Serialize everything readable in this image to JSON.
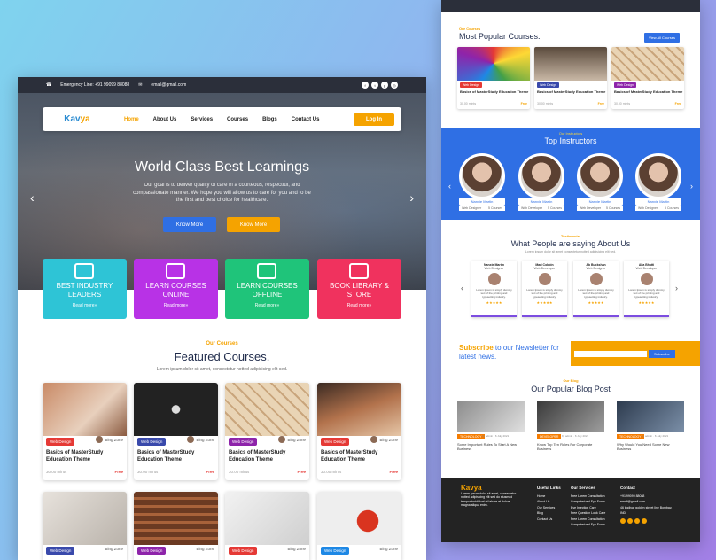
{
  "left": {
    "topbar": {
      "emergency": "Emergency Line: +91 99099 88088",
      "email": "email@gmail.com"
    },
    "nav": {
      "logo_a": "Kav",
      "logo_b": "ya",
      "items": [
        "Home",
        "About Us",
        "Services",
        "Courses",
        "Blogs",
        "Contact Us"
      ],
      "login": "Log In"
    },
    "hero": {
      "title": "World Class Best Learnings",
      "text": "Our goal is to deliver quality of care in a courteous, respectful, and compassionate manner. We hope you will allow us to care for you and to be the first and best choice for healthcare.",
      "btn1": "Know More",
      "btn2": "Know More"
    },
    "features": [
      {
        "title": "BEST INDUSTRY LEADERS",
        "link": "Read more»",
        "color": "#2ec4d6"
      },
      {
        "title": "LEARN COURSES ONLINE",
        "link": "Read more»",
        "color": "#b832e6"
      },
      {
        "title": "LEARN COURSES OFFLINE",
        "link": "Read more»",
        "color": "#1fc47a"
      },
      {
        "title": "BOOK LIBRARY & STORE",
        "link": "Read more»",
        "color": "#f0325e"
      }
    ],
    "featured": {
      "tag": "Our Courses",
      "title": "Featured Courses.",
      "sub": "Lorem ipsum dolor sit amet, consectetur notted adipisicing elit sed."
    },
    "cards": [
      {
        "cat": "Web Design",
        "cat_color": "#e53935",
        "author": "Bing Zone",
        "title": "Basics of MasterStudy Education Theme",
        "meta": "30.00 mints",
        "price": "Free"
      },
      {
        "cat": "Web Design",
        "cat_color": "#3949ab",
        "author": "Bing Zone",
        "title": "Basics of MasterStudy Education Theme",
        "meta": "30.00 mints",
        "price": "Free"
      },
      {
        "cat": "Web Design",
        "cat_color": "#8e24aa",
        "author": "Bing Zone",
        "title": "Basics of MasterStudy Education Theme",
        "meta": "30.00 mints",
        "price": "Free"
      },
      {
        "cat": "Web Design",
        "cat_color": "#e53935",
        "author": "Bing Zone",
        "title": "Basics of MasterStudy Education Theme",
        "meta": "30.00 mints",
        "price": "Free"
      }
    ],
    "cards2": [
      {
        "cat": "Web Design",
        "cat_color": "#3949ab",
        "author": "Bing Zone"
      },
      {
        "cat": "Web Design",
        "cat_color": "#8e24aa",
        "author": "Bing Zone"
      },
      {
        "cat": "Web Design",
        "cat_color": "#e53935",
        "author": "Bing Zone"
      },
      {
        "cat": "Web Design",
        "cat_color": "#1e88e5",
        "author": "Bing Zone"
      }
    ]
  },
  "right": {
    "popular": {
      "tag": "Our Courses",
      "title": "Most Popular Courses.",
      "btn": "View All Courses"
    },
    "rcards": [
      {
        "cat": "Web Design",
        "cat_color": "#e53935",
        "title": "Basics of MasterStudy Education Theme",
        "meta": "30.00 mints",
        "price": "Free"
      },
      {
        "cat": "Web Design",
        "cat_color": "#3949ab",
        "title": "Basics of MasterStudy Education Theme",
        "meta": "30.00 mints",
        "price": "Free"
      },
      {
        "cat": "Web Design",
        "cat_color": "#8e24aa",
        "title": "Basics of MasterStudy Education Theme",
        "meta": "30.00 mints",
        "price": "Free"
      }
    ],
    "instructors": {
      "tag": "Our Instructors",
      "title": "Top Instructors",
      "items": [
        {
          "name": "Nanxie Martin",
          "role": "Web Designer",
          "courses": "5 Courses"
        },
        {
          "name": "Nanxie Martin",
          "role": "Web Developer",
          "courses": "5 Courses"
        },
        {
          "name": "Nanxie Martin",
          "role": "Web Developer",
          "courses": "5 Courses"
        },
        {
          "name": "Nanxie Martin",
          "role": "Web Designer",
          "courses": "5 Courses"
        }
      ]
    },
    "testimonial": {
      "tag": "Testimonial",
      "title": "What People are saying About Us",
      "sub": "Lorem ipsum dolor sit amet consectetur notted adipisicing elit sed.",
      "items": [
        {
          "name": "Nanxie Martin",
          "role": "Web Designer",
          "text": "Lorem Ipsum is simply dummy text of the printing and typesetting industry.",
          "stars": "★★★★★"
        },
        {
          "name": "Mari Cobbin",
          "role": "Web Developer",
          "text": "Lorem Ipsum is simply dummy text of the printing and typesetting industry.",
          "stars": "★★★★★"
        },
        {
          "name": "Ab Buckshan",
          "role": "Web Designer",
          "text": "Lorem Ipsum is simply dummy text of the printing and typesetting industry.",
          "stars": "★★★★★"
        },
        {
          "name": "Alia Bhatti",
          "role": "Web Developer",
          "text": "Lorem Ipsum is simply dummy text of the printing and typesetting industry.",
          "stars": "★★★★★"
        }
      ]
    },
    "newsletter": {
      "subscribe": "Subscribe",
      "rest": "to our Newsletter for latest news.",
      "btn": "Subscribe"
    },
    "blog": {
      "tag": "Our Blog",
      "title": "Our Popular Blog Post",
      "items": [
        {
          "cat": "TECHNOLOGY",
          "meta": "by admin · 6 July 2021",
          "title": "Some Important Rules To Start A New Business"
        },
        {
          "cat": "DEVELOPER",
          "meta": "by admin · 6 July 2021",
          "title": "Know Top Ten Rules For Corporate Business"
        },
        {
          "cat": "TECHNOLOGY",
          "meta": "by admin · 6 July 2021",
          "title": "Why Would You Need Some New Business"
        }
      ]
    },
    "footer": {
      "about": "Lorem ipsum dolor sit amet, consectetur notted adipisicing elit sed do eiusmod tempor incididunt ut labore et dolore magna aliqua enim.",
      "useful": {
        "title": "Useful Links",
        "items": [
          "Home",
          "About Us",
          "Our Services",
          "Blog",
          "Contact Us"
        ]
      },
      "services": {
        "title": "Our Services",
        "items": [
          "Free Lorem Consultation",
          "Computerized Eye Exam",
          "Eye Infection Care",
          "Free Question Look Care",
          "Free Lorem Consultation",
          "Computerized Eye Exam"
        ]
      },
      "contact": {
        "title": "Contact",
        "items": [
          "+91 99099 88088",
          "email@gmail.com",
          "46 kodiyar golden street line Bombay, IND"
        ]
      }
    }
  }
}
